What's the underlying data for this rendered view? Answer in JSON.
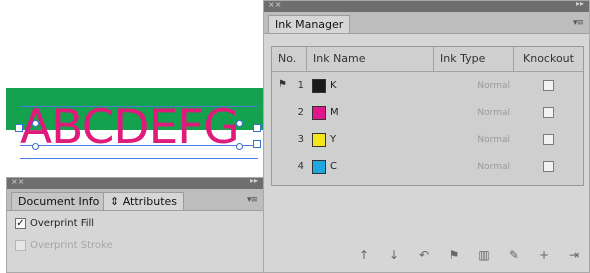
{
  "artwork": {
    "text": "ABCDEFG",
    "band_color": "#14a24f",
    "text_color": "#e01a7a"
  },
  "ink_manager": {
    "tab_label": "Ink Manager",
    "columns": [
      "No.",
      "Ink Name",
      "Ink Type",
      "Knockout"
    ],
    "inks": [
      {
        "no": "1",
        "name": "K",
        "color": "#1a1a1a",
        "type": "Normal",
        "knockout": false,
        "flag": true
      },
      {
        "no": "2",
        "name": "M",
        "color": "#e0168a",
        "type": "Normal",
        "knockout": false,
        "flag": false
      },
      {
        "no": "3",
        "name": "Y",
        "color": "#f5e61a",
        "type": "Normal",
        "knockout": false,
        "flag": false
      },
      {
        "no": "4",
        "name": "C",
        "color": "#1ea7e0",
        "type": "Normal",
        "knockout": false,
        "flag": false
      }
    ],
    "toolbar_icons": [
      "move-up-icon",
      "move-down-icon",
      "undo-icon",
      "flag-icon",
      "chart-icon",
      "edit-icon",
      "add-icon",
      "export-icon"
    ]
  },
  "attributes_panel": {
    "tabs": [
      "Document Info",
      "Attributes"
    ],
    "options": [
      {
        "label": "Overprint Fill",
        "checked": true,
        "enabled": true
      },
      {
        "label": "Overprint Stroke",
        "checked": false,
        "enabled": false
      }
    ]
  }
}
